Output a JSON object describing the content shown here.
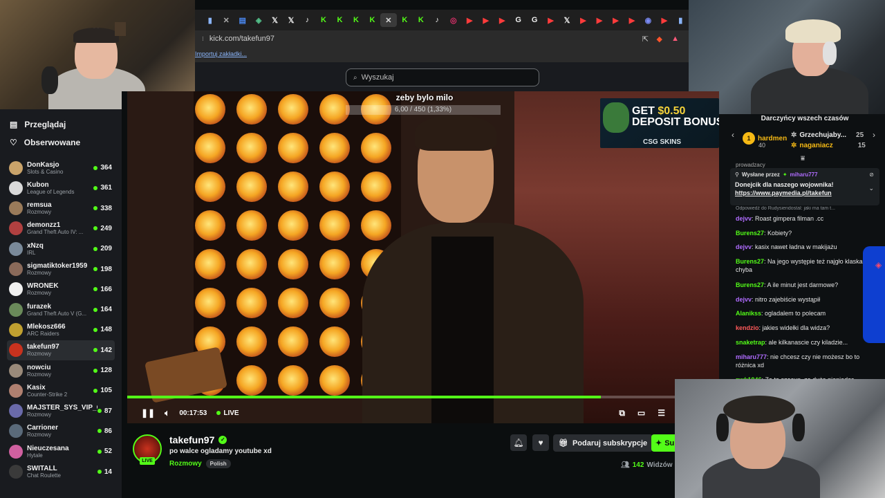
{
  "browser": {
    "url": "kick.com/takefun97",
    "bookmarks_label": "Importuj zakładki..."
  },
  "header": {
    "search_placeholder": "Wyszukaj"
  },
  "sidebar": {
    "nav": [
      {
        "label": "Przeglądaj",
        "icon": "browse-icon"
      },
      {
        "label": "Obserwowane",
        "icon": "heart-icon"
      }
    ],
    "channels": [
      {
        "name": "DonKasjo",
        "category": "Slots & Casino",
        "viewers": "364",
        "color": "#c9a36a"
      },
      {
        "name": "Kubon",
        "category": "League of Legends",
        "viewers": "361",
        "color": "#d9d9d9"
      },
      {
        "name": "remsua",
        "category": "Rozmowy",
        "viewers": "338",
        "color": "#9a7b5a"
      },
      {
        "name": "demonzz1",
        "category": "Grand Theft Auto IV: ...",
        "viewers": "249",
        "color": "#b04040"
      },
      {
        "name": "xNzq",
        "category": "IRL",
        "viewers": "209",
        "color": "#7a8a9a"
      },
      {
        "name": "sigmatiktoker1959",
        "category": "Rozmowy",
        "viewers": "198",
        "color": "#8a6a5a"
      },
      {
        "name": "WRONEK",
        "category": "Rozmowy",
        "viewers": "166",
        "color": "#f0f0f0"
      },
      {
        "name": "furazek",
        "category": "Grand Theft Auto V (G...",
        "viewers": "164",
        "color": "#6a8a5a"
      },
      {
        "name": "Mlekosz666",
        "category": "ARC Raiders",
        "viewers": "148",
        "color": "#c0a030"
      },
      {
        "name": "takefun97",
        "category": "Rozmowy",
        "viewers": "142",
        "color": "#c8321e",
        "active": true
      },
      {
        "name": "nowciu",
        "category": "Rozmowy",
        "viewers": "128",
        "color": "#9a8a7a"
      },
      {
        "name": "Kasix",
        "category": "Counter-Strike 2",
        "viewers": "105",
        "color": "#b08070"
      },
      {
        "name": "MAJSTER_SYS_VIP_C",
        "category": "Rozmowy",
        "viewers": "87",
        "color": "#6a6aaa"
      },
      {
        "name": "Carrioner",
        "category": "Rozmowy",
        "viewers": "86",
        "color": "#5a6a7a"
      },
      {
        "name": "Nieuczesana",
        "category": "Hytale",
        "viewers": "52",
        "color": "#d060a0"
      },
      {
        "name": "SWITALL",
        "category": "Chat Roulette",
        "viewers": "14",
        "color": "#3a3a3a"
      }
    ]
  },
  "video": {
    "overlay_title": "zeby bylo milo",
    "overlay_progress": "6,00 / 450 (1,33%)",
    "ad_line1_prefix": "GET ",
    "ad_line1_amount": "$0.50",
    "ad_line2": "DEPOSIT BONUS",
    "ad_brand": "CSG SKINS",
    "time": "00:17:53",
    "live_label": "LIVE",
    "progress": 0.8
  },
  "stream": {
    "name": "takefun97",
    "title": "po walce ogladamy youtube xd",
    "category": "Rozmowy",
    "tag": "Polish",
    "live_badge": "LIVE",
    "gift_label": "Podaruj subskrypcje",
    "sub_label": "Su",
    "viewers_count": "142",
    "viewers_label": "Widzów"
  },
  "chat": {
    "leaderboard_title": "Darczyńcy wszech czasów",
    "leaders": [
      {
        "rank": "1",
        "name": "hardmen",
        "amount": "40"
      },
      {
        "name": "Grzechujaby...",
        "amount": "25"
      },
      {
        "name": "naganiacz",
        "amount": "15"
      }
    ],
    "cut_off_text": "prowadzacy",
    "pinned": {
      "sent_by": "Wysłane przez",
      "sender": "miharu777",
      "text": "Donejcik dla naszego wojownika!",
      "link": "https://www.paymedia.pl/takefun"
    },
    "reply_hint": "Odpowiedź do Rudysiendostal: jaki ma tam t...",
    "messages": [
      {
        "user": "dejvv",
        "color": "#b06cff",
        "text": "Roast gimpera filman .cc"
      },
      {
        "user": "Burens27",
        "color": "#53fc18",
        "text": "Kobiety?"
      },
      {
        "user": "dejvv",
        "color": "#b06cff",
        "text": "kasix nawet ładna w makijażu"
      },
      {
        "user": "Burens27",
        "color": "#53fc18",
        "text": "Na jego występie też najgło klaskali chyba"
      },
      {
        "user": "Burens27",
        "color": "#53fc18",
        "text": "A ile minut jest darmowe?"
      },
      {
        "user": "dejvv",
        "color": "#b06cff",
        "text": "nitro zajebiście wystąpił"
      },
      {
        "user": "Alanikss",
        "color": "#53fc18",
        "text": "ogladalem to polecam"
      },
      {
        "user": "kendzio",
        "color": "#ff5a5a",
        "text": "jakies widełki dla widza?"
      },
      {
        "user": "snaketrap",
        "color": "#53fc18",
        "text": "ale kilkanascie czy kiladzie..."
      },
      {
        "user": "miharu777",
        "color": "#b06cff",
        "text": "nie chcesz czy nie możesz bo to różnica xd"
      },
      {
        "user": "pwk1946",
        "color": "#53fc18",
        "text": "Za to szacun, za duże pieniądze"
      }
    ]
  },
  "colors": {
    "accent": "#53fc18",
    "background": "#0b0e0f",
    "sidebar": "#191b1f"
  }
}
